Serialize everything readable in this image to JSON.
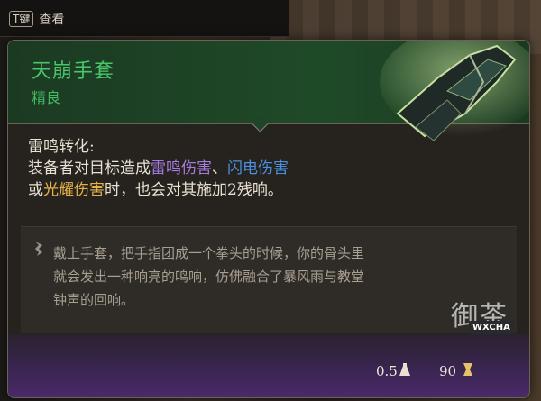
{
  "hint": {
    "key": "T键",
    "label": "查看"
  },
  "item": {
    "name": "天崩手套",
    "rarity": "精良",
    "ability_title": "雷鸣转化:",
    "line1_prefix": "装备者对目标造成",
    "thunder_damage": "雷鸣伤害",
    "separator": "、",
    "lightning_damage": "闪电伤害",
    "line2_prefix": "或",
    "radiant_damage": "光耀伤害",
    "line2_suffix": "时，也会对其施加2残响。",
    "flavor_lines": [
      "戴上手套，把手指团成一个拳头的时候，你的骨头里",
      "就会发出一种响亮的鸣响，仿佛融合了暴风雨与教堂",
      "钟声的回响。"
    ],
    "weight": "0.5",
    "price": "90"
  },
  "watermark": {
    "text": "御茶",
    "badge": "WXCHA"
  },
  "colors": {
    "name": "#49c66a",
    "thunder": "#a57be0",
    "lightning": "#4b8fe0",
    "radiant": "#e6b34a"
  },
  "icons": {
    "glove": "gauntlet-icon",
    "flavor": "quill-icon",
    "weight": "weight-icon",
    "price": "coin-icon"
  }
}
